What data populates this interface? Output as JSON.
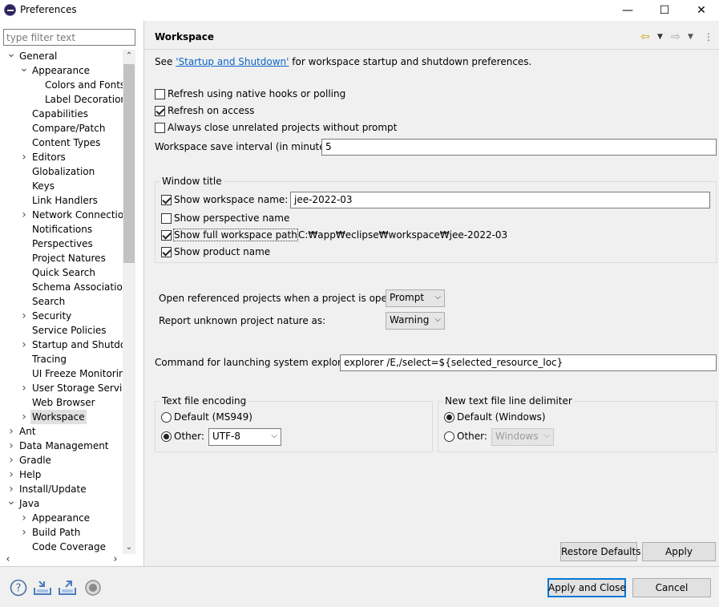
{
  "window": {
    "title": "Preferences",
    "minimize_glyph": "—",
    "maximize_glyph": "☐",
    "close_glyph": "✕"
  },
  "sidebar": {
    "filter_placeholder": "type filter text",
    "tree": [
      {
        "label": "General",
        "level": 0,
        "state": "expanded"
      },
      {
        "label": "Appearance",
        "level": 1,
        "state": "expanded"
      },
      {
        "label": "Colors and Fonts",
        "level": 2,
        "state": "leaf"
      },
      {
        "label": "Label Decorations",
        "level": 2,
        "state": "leaf"
      },
      {
        "label": "Capabilities",
        "level": 1,
        "state": "leaf"
      },
      {
        "label": "Compare/Patch",
        "level": 1,
        "state": "leaf"
      },
      {
        "label": "Content Types",
        "level": 1,
        "state": "leaf"
      },
      {
        "label": "Editors",
        "level": 1,
        "state": "collapsed"
      },
      {
        "label": "Globalization",
        "level": 1,
        "state": "leaf"
      },
      {
        "label": "Keys",
        "level": 1,
        "state": "leaf"
      },
      {
        "label": "Link Handlers",
        "level": 1,
        "state": "leaf"
      },
      {
        "label": "Network Connections",
        "level": 1,
        "state": "collapsed"
      },
      {
        "label": "Notifications",
        "level": 1,
        "state": "leaf"
      },
      {
        "label": "Perspectives",
        "level": 1,
        "state": "leaf"
      },
      {
        "label": "Project Natures",
        "level": 1,
        "state": "leaf"
      },
      {
        "label": "Quick Search",
        "level": 1,
        "state": "leaf"
      },
      {
        "label": "Schema Associations",
        "level": 1,
        "state": "leaf"
      },
      {
        "label": "Search",
        "level": 1,
        "state": "leaf"
      },
      {
        "label": "Security",
        "level": 1,
        "state": "collapsed"
      },
      {
        "label": "Service Policies",
        "level": 1,
        "state": "leaf"
      },
      {
        "label": "Startup and Shutdown",
        "level": 1,
        "state": "collapsed"
      },
      {
        "label": "Tracing",
        "level": 1,
        "state": "leaf"
      },
      {
        "label": "UI Freeze Monitoring",
        "level": 1,
        "state": "leaf"
      },
      {
        "label": "User Storage Service",
        "level": 1,
        "state": "collapsed"
      },
      {
        "label": "Web Browser",
        "level": 1,
        "state": "leaf"
      },
      {
        "label": "Workspace",
        "level": 1,
        "state": "collapsed",
        "selected": true
      },
      {
        "label": "Ant",
        "level": 0,
        "state": "collapsed"
      },
      {
        "label": "Data Management",
        "level": 0,
        "state": "collapsed"
      },
      {
        "label": "Gradle",
        "level": 0,
        "state": "collapsed"
      },
      {
        "label": "Help",
        "level": 0,
        "state": "collapsed"
      },
      {
        "label": "Install/Update",
        "level": 0,
        "state": "collapsed"
      },
      {
        "label": "Java",
        "level": 0,
        "state": "expanded"
      },
      {
        "label": "Appearance",
        "level": 1,
        "state": "collapsed"
      },
      {
        "label": "Build Path",
        "level": 1,
        "state": "collapsed"
      },
      {
        "label": "Code Coverage",
        "level": 1,
        "state": "leaf"
      }
    ]
  },
  "page": {
    "title": "Workspace",
    "desc_prefix": "See ",
    "desc_link": "'Startup and Shutdown'",
    "desc_suffix": " for workspace startup and shutdown preferences.",
    "refresh_native": {
      "label": "Refresh using native hooks or polling",
      "checked": false
    },
    "refresh_access": {
      "label": "Refresh on access",
      "checked": true
    },
    "always_close": {
      "label": "Always close unrelated projects without prompt",
      "checked": false
    },
    "save_interval": {
      "label": "Workspace save interval (in minutes):",
      "value": "5"
    },
    "window_title": {
      "group_label": "Window title",
      "show_ws_name": {
        "label": "Show workspace name:",
        "checked": true,
        "value": "jee-2022-03"
      },
      "show_perspective": {
        "label": "Show perspective name",
        "checked": false
      },
      "show_full_path": {
        "label": "Show full workspace path",
        "checked": true,
        "path": "C:₩app₩eclipse₩workspace₩jee-2022-03"
      },
      "show_product": {
        "label": "Show product name",
        "checked": true
      }
    },
    "open_ref": {
      "label": "Open referenced projects when a project is opened:",
      "value": "Prompt"
    },
    "unknown_nature": {
      "label": "Report unknown project nature as:",
      "value": "Warning"
    },
    "explorer_cmd": {
      "label": "Command for launching system explorer:",
      "value": "explorer /E,/select=${selected_resource_loc}"
    },
    "encoding": {
      "group_label": "Text file encoding",
      "default_label": "Default (MS949)",
      "other_label": "Other:",
      "other_value": "UTF-8",
      "selected": "other"
    },
    "delimiter": {
      "group_label": "New text file line delimiter",
      "default_label": "Default (Windows)",
      "other_label": "Other:",
      "other_value": "Windows",
      "selected": "default"
    },
    "restore_defaults": "Restore Defaults",
    "apply": "Apply"
  },
  "footer": {
    "apply_close": "Apply and Close",
    "cancel": "Cancel"
  }
}
